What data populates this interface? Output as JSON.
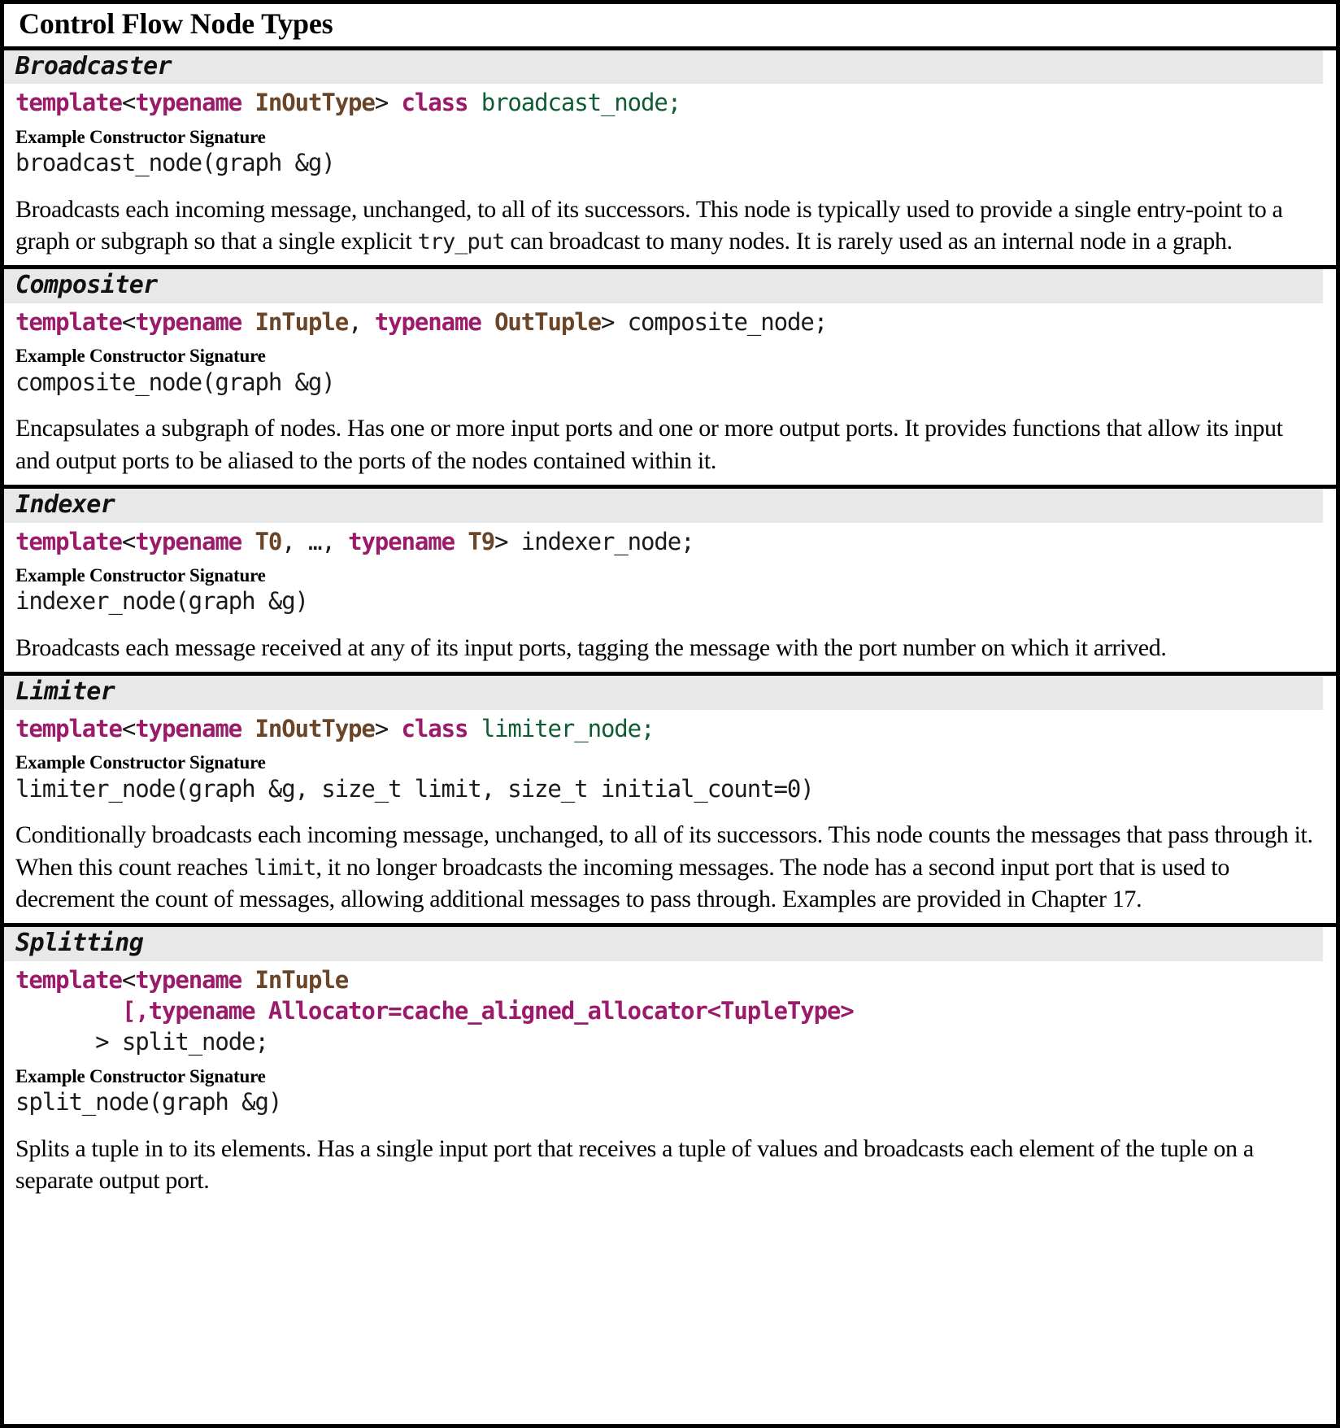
{
  "table": {
    "title": "Control Flow Node Types",
    "colors": {
      "keyword": "#9b1b6a",
      "type": "#6b4528",
      "class_name": "#0e5c34",
      "header_band": "#e8e8e8",
      "border": "#000000",
      "text": "#000000"
    },
    "ctor_label": "Example Constructor Signature",
    "sections": [
      {
        "name": "Broadcaster",
        "declaration": [
          [
            {
              "t": "template",
              "c": "kw"
            },
            {
              "t": "<",
              "c": "plain"
            },
            {
              "t": "typename",
              "c": "kw2"
            },
            {
              "t": " ",
              "c": "plain"
            },
            {
              "t": "InOutType",
              "c": "type"
            },
            {
              "t": "> ",
              "c": "plain"
            },
            {
              "t": "class",
              "c": "kw"
            },
            {
              "t": " ",
              "c": "plain"
            },
            {
              "t": "broadcast_node",
              "c": "cls"
            },
            {
              "t": ";",
              "c": "cls"
            }
          ]
        ],
        "constructor": "broadcast_node(graph &g)",
        "description_parts": [
          {
            "t": "Broadcasts each incoming message, unchanged, to all of its successors. This node is typically used to provide a single entry-point to a graph or subgraph so that a single explicit ",
            "code": false
          },
          {
            "t": "try_put",
            "code": true
          },
          {
            "t": " can broadcast to many nodes. It is rarely used as an internal node in a graph.",
            "code": false
          }
        ]
      },
      {
        "name": "Compositer",
        "declaration": [
          [
            {
              "t": "template",
              "c": "kw"
            },
            {
              "t": "<",
              "c": "plain"
            },
            {
              "t": "typename",
              "c": "kw2"
            },
            {
              "t": " ",
              "c": "plain"
            },
            {
              "t": "InTuple",
              "c": "type"
            },
            {
              "t": ", ",
              "c": "plain"
            },
            {
              "t": "typename",
              "c": "kw2"
            },
            {
              "t": " ",
              "c": "plain"
            },
            {
              "t": "OutTuple",
              "c": "type"
            },
            {
              "t": "> composite_node;",
              "c": "plain"
            }
          ]
        ],
        "constructor": "composite_node(graph &g)",
        "description_parts": [
          {
            "t": "Encapsulates a subgraph of nodes. Has one or more input ports and one or more output ports. It provides functions that allow its input and output ports to be aliased to the ports of the nodes contained within it.",
            "code": false
          }
        ]
      },
      {
        "name": "Indexer",
        "declaration": [
          [
            {
              "t": "template",
              "c": "kw"
            },
            {
              "t": "<",
              "c": "plain"
            },
            {
              "t": "typename",
              "c": "kw2"
            },
            {
              "t": " ",
              "c": "plain"
            },
            {
              "t": "T0",
              "c": "type"
            },
            {
              "t": ", …, ",
              "c": "plain"
            },
            {
              "t": "typename",
              "c": "kw2"
            },
            {
              "t": " ",
              "c": "plain"
            },
            {
              "t": "T9",
              "c": "type"
            },
            {
              "t": "> indexer_node;",
              "c": "plain"
            }
          ]
        ],
        "constructor": "indexer_node(graph &g)",
        "description_parts": [
          {
            "t": "Broadcasts each message received at any of its input ports, tagging the message with the port number on which it arrived.",
            "code": false
          }
        ]
      },
      {
        "name": "Limiter",
        "declaration": [
          [
            {
              "t": "template",
              "c": "kw"
            },
            {
              "t": "<",
              "c": "plain"
            },
            {
              "t": "typename",
              "c": "kw2"
            },
            {
              "t": " ",
              "c": "plain"
            },
            {
              "t": "InOutType",
              "c": "type"
            },
            {
              "t": "> ",
              "c": "plain"
            },
            {
              "t": "class",
              "c": "kw"
            },
            {
              "t": " ",
              "c": "plain"
            },
            {
              "t": "limiter_node",
              "c": "cls"
            },
            {
              "t": ";",
              "c": "cls"
            }
          ]
        ],
        "constructor": "limiter_node(graph &g, size_t limit, size_t initial_count=0)",
        "description_parts": [
          {
            "t": "Conditionally broadcasts each incoming message, unchanged, to all of its successors. This node counts the messages that pass through it.   When this count reaches ",
            "code": false
          },
          {
            "t": "limit",
            "code": true
          },
          {
            "t": ", it no longer broadcasts the incoming messages. The node has a second input port that is used to decrement the count of messages, allowing additional messages to pass through. Examples are provided in Chapter 17.",
            "code": false
          }
        ]
      },
      {
        "name": "Splitting",
        "declaration": [
          [
            {
              "t": "template",
              "c": "kw"
            },
            {
              "t": "<",
              "c": "plain"
            },
            {
              "t": "typename",
              "c": "kw2"
            },
            {
              "t": " ",
              "c": "plain"
            },
            {
              "t": "InTuple",
              "c": "type"
            }
          ],
          [
            {
              "t": "        [,typename Allocator=cache_aligned_allocator<TupleType>",
              "c": "magenta"
            }
          ],
          [
            {
              "t": "      > split_node;",
              "c": "plain"
            }
          ]
        ],
        "constructor": "split_node(graph &g)",
        "description_parts": [
          {
            "t": "Splits a tuple in to its elements. Has a single input port that receives a tuple of values and broadcasts each element of the tuple on a separate output port.",
            "code": false
          }
        ]
      }
    ]
  }
}
